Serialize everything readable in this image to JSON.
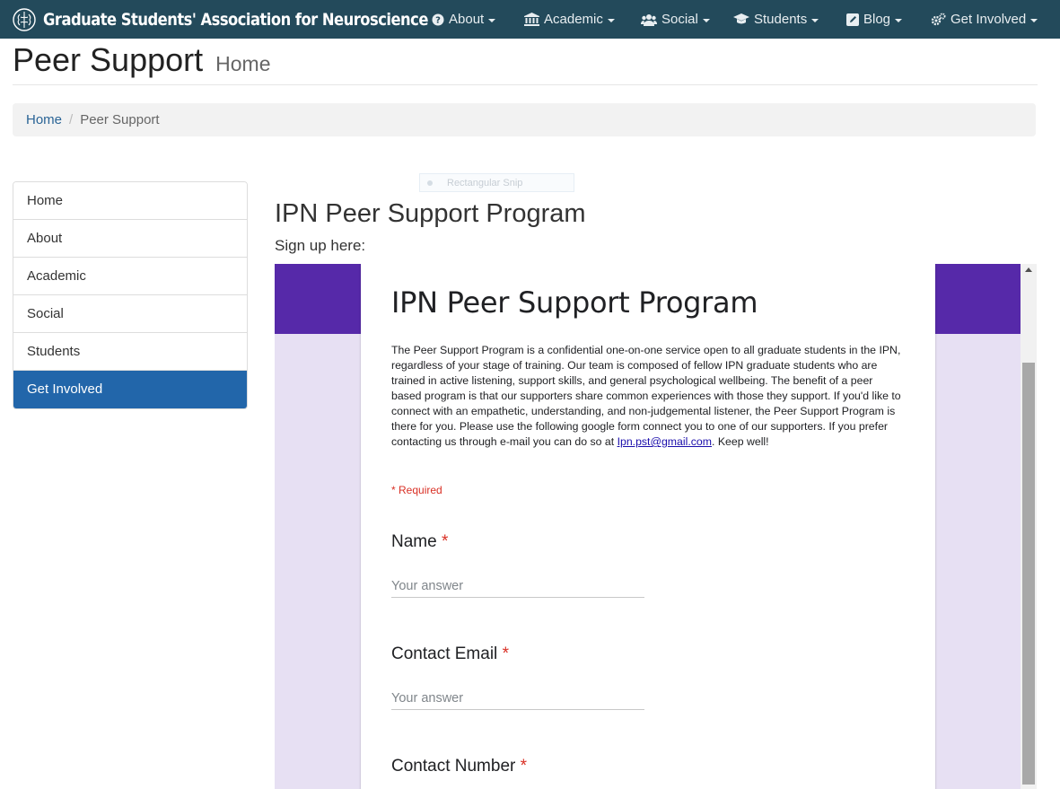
{
  "navbar": {
    "brand": "Graduate Students' Association for Neuroscience",
    "items": [
      {
        "label": "About",
        "icon": "question-circle-icon"
      },
      {
        "label": "Academic",
        "icon": "institution-icon"
      },
      {
        "label": "Social",
        "icon": "users-icon"
      },
      {
        "label": "Students",
        "icon": "graduation-cap-icon"
      },
      {
        "label": "Blog",
        "icon": "edit-icon"
      },
      {
        "label": "Get Involved",
        "icon": "cogs-icon"
      }
    ]
  },
  "header": {
    "title": "Peer Support",
    "subtitle": "Home"
  },
  "breadcrumb": {
    "home": "Home",
    "current": "Peer Support"
  },
  "sidebar": {
    "items": [
      {
        "label": "Home"
      },
      {
        "label": "About"
      },
      {
        "label": "Academic"
      },
      {
        "label": "Social"
      },
      {
        "label": "Students"
      },
      {
        "label": "Get Involved",
        "active": true
      }
    ]
  },
  "snip_overlay": "Rectangular Snip",
  "main": {
    "title": "IPN Peer Support Program",
    "signup": "Sign up here:"
  },
  "form": {
    "title": "IPN Peer Support Program",
    "description": "The Peer Support Program is a confidential one-on-one service open to all graduate students in the IPN, regardless of your stage of training. Our team is composed of fellow IPN graduate students who are trained in active listening, support skills, and general psychological wellbeing.  The benefit of a peer based program is that our supporters share common experiences with those they support.  If you'd like to connect with an empathetic, understanding, and non-judgemental listener, the Peer Support Program is there for you. Please use the following google form connect you to one of our supporters. If you prefer contacting us through e-mail you can do so at",
    "email_link": "Ipn.pst@gmail.com",
    "description_end": ". Keep well!",
    "required_note": "* Required",
    "questions": [
      {
        "label": "Name",
        "required_mark": "*",
        "placeholder": "Your answer"
      },
      {
        "label": "Contact Email",
        "required_mark": "*",
        "placeholder": "Your answer"
      },
      {
        "label": "Contact Number",
        "required_mark": "*"
      }
    ]
  },
  "colors": {
    "navbar": "#234a5b",
    "sidebar_active": "#2266aa",
    "form_header": "#5629a9",
    "form_background": "#e7e0f3",
    "required": "#d93025"
  }
}
